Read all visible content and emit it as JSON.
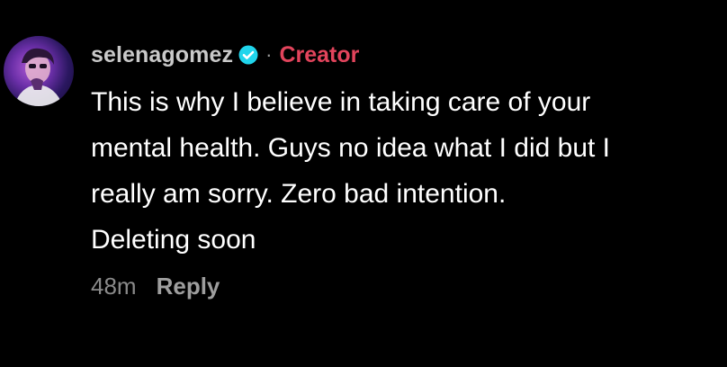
{
  "comment": {
    "username": "selenagomez",
    "separator": "·",
    "role_badge": "Creator",
    "verified_icon": "verified-check-icon",
    "text_lines": [
      "This is why I believe in taking care of your",
      "mental health. Guys no idea what I did but I",
      "really am sorry. Zero bad intention.",
      "Deleting soon"
    ],
    "timestamp": "48m",
    "reply_label": "Reply"
  },
  "colors": {
    "background": "#000000",
    "username": "#c9c9c9",
    "creator": "#e2445c",
    "body_text": "#ffffff",
    "meta_text": "#8a8a8a",
    "verified": "#20d5ec"
  }
}
